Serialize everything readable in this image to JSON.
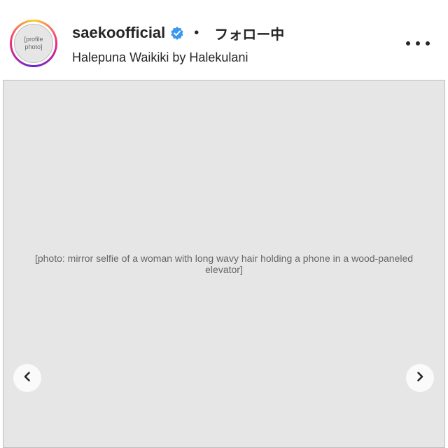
{
  "header": {
    "username": "saekoofficial",
    "verified_icon": "verified-badge-icon",
    "separator": "•",
    "follow_status": "フォロー中",
    "location": "Halepuna Waikiki by Halekulani",
    "more_icon": "more-options-icon"
  },
  "avatar": {
    "placeholder": "[profile photo]"
  },
  "photo": {
    "placeholder": "[photo: mirror selfie of a woman with long wavy hair holding a phone in a wood-paneled elevator]"
  },
  "carousel": {
    "prev_icon": "chevron-left-icon",
    "next_icon": "chevron-right-icon"
  },
  "colors": {
    "verified": "#3897f0",
    "text": "#262626"
  }
}
